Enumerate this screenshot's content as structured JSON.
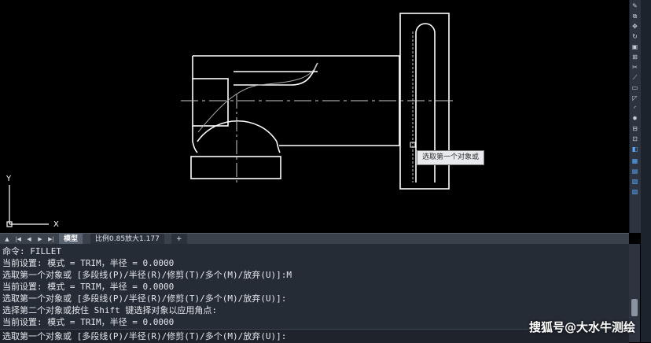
{
  "ucs": {
    "x_label": "X",
    "y_label": "Y"
  },
  "tooltip": {
    "text": "选取第一个对象或"
  },
  "tabs": {
    "model_label": "模型",
    "layout_label": "比例0.85放大1.177",
    "add_label": "+"
  },
  "command_history": [
    "命令: FILLET",
    "当前设置: 模式 = TRIM，半径 = 0.0000",
    "选取第一个对象或 [多段线(P)/半径(R)/修剪(T)/多个(M)/放弃(U)]:M",
    "当前设置: 模式 = TRIM，半径 = 0.0000",
    "选取第一个对象或 [多段线(P)/半径(R)/修剪(T)/多个(M)/放弃(U)]:",
    "选择第二个对象或按住 Shift 键选择对象以应用角点:",
    "当前设置: 模式 = TRIM，半径 = 0.0000"
  ],
  "command_input": {
    "prompt": "选取第一个对象或 [多段线(P)/半径(R)/修剪(T)/多个(M)/放弃(U)]:"
  },
  "watermark": {
    "text": "搜狐号@大水牛测绘"
  },
  "colors": {
    "canvas": "#000000",
    "geometry": "#ffffff",
    "cmd_bg": "#262c35",
    "toolbar": "#2d3440"
  }
}
